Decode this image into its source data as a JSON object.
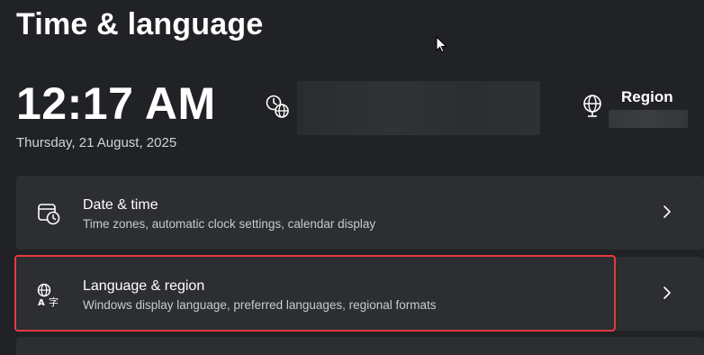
{
  "page": {
    "title": "Time & language"
  },
  "clock": {
    "time": "12:17 AM",
    "date": "Thursday, 21 August, 2025"
  },
  "region": {
    "label": "Region"
  },
  "cards": [
    {
      "title": "Date & time",
      "description": "Time zones, automatic clock settings, calendar display",
      "icon": "calendar-clock-icon"
    },
    {
      "title": "Language & region",
      "description": "Windows display language, preferred languages, regional formats",
      "icon": "language-icon"
    }
  ],
  "colors": {
    "background": "#202225",
    "card": "#2c2e31",
    "highlight": "#e5393f"
  }
}
